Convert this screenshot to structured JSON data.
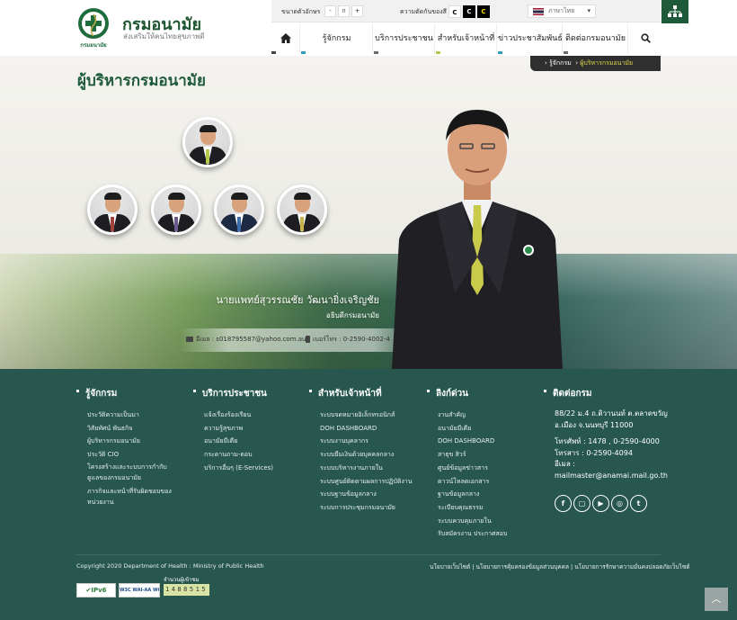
{
  "header": {
    "logo_title": "กรมอนามัย",
    "logo_sub": "ส่งเสริมให้คนไทยสุขภาพดี",
    "seal_text": "กรมอนามัย",
    "font_size_label": "ขนาดตัวอักษร",
    "font_buttons": [
      "-",
      "ก",
      "+"
    ],
    "contrast_label": "ความตัดกันของสี",
    "contrast_buttons": [
      "C",
      "C",
      "C"
    ],
    "language": "ภาษาไทย",
    "nav": [
      {
        "label": "",
        "icon": "home-icon",
        "color": "#444444"
      },
      {
        "label": "รู้จักกรม",
        "color": "#2f9fbf"
      },
      {
        "label": "บริการประชาชน",
        "color": "#6c6c6c"
      },
      {
        "label": "สำหรับเจ้าหน้าที่",
        "color": "#b5c94e"
      },
      {
        "label": "ข่าวประชาสัมพันธ์",
        "color": "#2f9fbf"
      },
      {
        "label": "ติดต่อกรมอนามัย",
        "color": "#6c6c6c"
      },
      {
        "label": "",
        "icon": "search-icon",
        "color": "#ffffff"
      }
    ]
  },
  "breadcrumb": {
    "home": "รู้จักกรม",
    "current": "ผู้บริหารกรมอนามัย"
  },
  "page_title": "ผู้บริหารกรมอนามัย",
  "director": {
    "name": "นายแพทย์สุวรรณชัย วัฒนายิ่งเจริญชัย",
    "position": "อธิบดีกรมอนามัย",
    "email": "อีเมล : s018795587@yahoo.com.au",
    "phone": "เบอร์โทร : 0-2590-4002-4"
  },
  "footer": {
    "columns": [
      {
        "title": "รู้จักกรม",
        "items": [
          "ประวัติความเป็นมา",
          "วิสัยทัศน์ พันธกิจ",
          "ผู้บริหารกรมอนามัย",
          "ประวัติ CIO",
          "โครงสร้างและระบบการกำกับดูแลของกรมอนามัย",
          "ภารกิจและหน้าที่รับผิดชอบของหน่วยงาน"
        ]
      },
      {
        "title": "บริการประชาชน",
        "items": [
          "แจ้งเรื่องร้องเรียน",
          "ความรู้สุขภาพ",
          "อนามัยมีเดีย",
          "กระดานถาม-ตอบ",
          "บริการอื่นๆ (E-Services)"
        ]
      },
      {
        "title": "สำหรับเจ้าหน้าที่",
        "items": [
          "ระบบจดหมายอิเล็กทรอนิกส์",
          "DOH DASHBOARD",
          "ระบบงานบุคลากร",
          "ระบบยืมเงินด้วยบุคคลกลาง",
          "ระบบบริหารงานภายใน",
          "ระบบศูนย์ติดตามผลการปฏิบัติงาน",
          "ระบบฐานข้อมูลกลาง",
          "ระบบการประชุมกรมอนามัย"
        ]
      },
      {
        "title": "ลิงก์ด่วน",
        "items": [
          "งานสำคัญ",
          "อนามัยมีเดีย",
          "DOH DASHBOARD",
          "สาธุข สิวร์",
          "ศูนย์ข้อมูลข่าวสาร",
          "ดาวน์โหลดเอกสาร",
          "ฐานข้อมูลกลาง",
          "ระเบียบคุณธรรม",
          "ระบบควบคุมภายใน",
          "รับสมัครงาน ประกาศสอบ"
        ]
      },
      {
        "title": "ติดต่อกรม",
        "address": [
          "88/22 ม.4 ถ.ติวานนท์ ต.ตลาดขวัญ",
          "อ.เมือง จ.นนทบุรี 11000",
          "โทรศัพท์ : 1478 , 0-2590-4000",
          "โทรสาร : 0-2590-4094",
          "อีเมล :",
          "mailmaster@anamai.mail.go.th"
        ]
      }
    ],
    "social": [
      {
        "name": "facebook-icon",
        "glyph": "f"
      },
      {
        "name": "line-icon",
        "glyph": "▢"
      },
      {
        "name": "youtube-icon",
        "glyph": "▶"
      },
      {
        "name": "instagram-icon",
        "glyph": "◎"
      },
      {
        "name": "twitter-icon",
        "glyph": "t"
      }
    ],
    "copyright": "Copyright 2020 Department of Health : Ministry of Public Health",
    "policy": "นโยบายเว็บไซต์ | นโยบายการคุ้มครองข้อมูลส่วนบุคคล | นโยบายการรักษาความมั่นคงปลอดภัยเว็บไซต์",
    "badges": {
      "ipv6": "IPv6",
      "wcag": "W3C WAI-AA WCAG 2.0"
    },
    "counter_label": "จำนวนผู้เข้าชม",
    "counter": "1488515",
    "totop": "︿"
  },
  "colors": {
    "brand_green": "#1e5a3a",
    "footer": "#27574f",
    "accent_yellow": "#e0d64a"
  }
}
